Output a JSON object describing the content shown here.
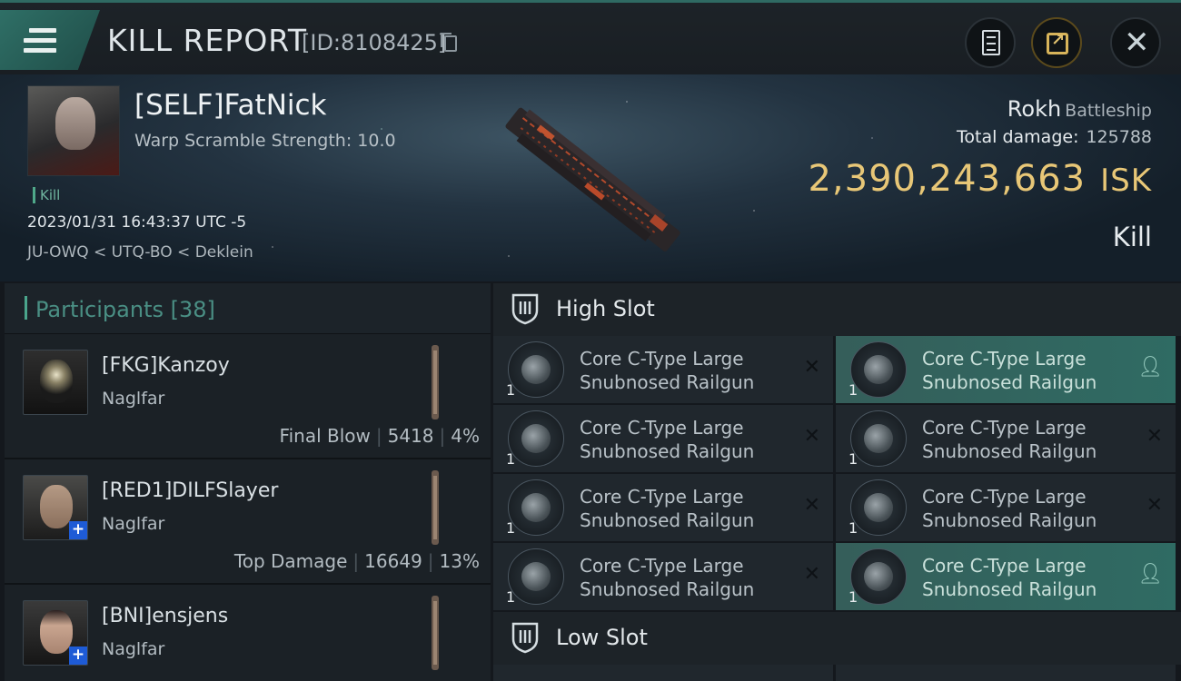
{
  "header": {
    "title": "KILL REPORT",
    "id_label": "[ID:8108425]"
  },
  "victim": {
    "name": "[SELF]FatNick",
    "warp_scramble": "Warp Scramble Strength: 10.0",
    "tag": "Kill",
    "timestamp": "2023/01/31 16:43:37 UTC -5",
    "location": "JU-OWQ < UTQ-BO < Deklein",
    "ship_name": "Rokh",
    "ship_class": "Battleship",
    "total_damage_label": "Total damage:",
    "total_damage_value": "125788",
    "isk_value": "2,390,243,663",
    "isk_unit": "ISK",
    "outcome": "Kill"
  },
  "participants": {
    "label": "Participants [38]",
    "rows": [
      {
        "name": "[FKG]Kanzoy",
        "ship": "Naglfar",
        "role": "Final Blow",
        "damage": "5418",
        "percent": "4%"
      },
      {
        "name": "[RED1]DILFSlayer",
        "ship": "Naglfar",
        "role": "Top Damage",
        "damage": "16649",
        "percent": "13%"
      },
      {
        "name": "[BNI]ensjens",
        "ship": "Naglfar"
      }
    ]
  },
  "high_slot": {
    "label": "High Slot",
    "items": [
      {
        "line1": "Core C-Type Large",
        "line2": "Snubnosed Railgun",
        "qty": "1",
        "status": "destroyed"
      },
      {
        "line1": "Core C-Type Large",
        "line2": "Snubnosed Railgun",
        "qty": "1",
        "status": "dropped"
      },
      {
        "line1": "Core C-Type Large",
        "line2": "Snubnosed Railgun",
        "qty": "1",
        "status": "destroyed"
      },
      {
        "line1": "Core C-Type Large",
        "line2": "Snubnosed Railgun",
        "qty": "1",
        "status": "destroyed"
      },
      {
        "line1": "Core C-Type Large",
        "line2": "Snubnosed Railgun",
        "qty": "1",
        "status": "destroyed"
      },
      {
        "line1": "Core C-Type Large",
        "line2": "Snubnosed Railgun",
        "qty": "1",
        "status": "destroyed"
      },
      {
        "line1": "Core C-Type Large",
        "line2": "Snubnosed Railgun",
        "qty": "1",
        "status": "destroyed"
      },
      {
        "line1": "Core C-Type Large",
        "line2": "Snubnosed Railgun",
        "qty": "1",
        "status": "dropped"
      }
    ]
  },
  "low_slot": {
    "label": "Low Slot"
  },
  "icons": {
    "menu": "menu-icon",
    "copy": "copy-icon",
    "clipboard": "clipboard-icon",
    "share": "share-icon",
    "close": "close-icon",
    "shield": "shield-icon",
    "destroyed": "x-icon",
    "dropped": "person-icon"
  },
  "colors": {
    "accent": "#2f6f66",
    "isk": "#e8c777",
    "kill_tag": "#4fa88a",
    "highlight": "#2f6b63"
  }
}
